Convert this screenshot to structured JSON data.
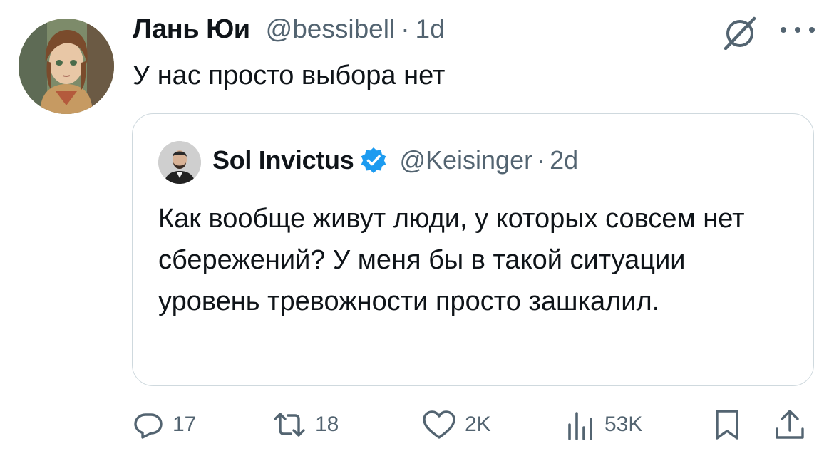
{
  "tweet": {
    "display_name": "Лань Юи",
    "handle": "@bessibell",
    "separator": "·",
    "time": "1d",
    "text": "У нас просто выбора нет"
  },
  "quote": {
    "display_name": "Sol Invictus",
    "handle": "@Keisinger",
    "separator": "·",
    "time": "2d",
    "text": "Как вообще живут люди, у которых совсем нет сбережений? У меня бы в такой ситуации уровень тревожности просто зашкалил."
  },
  "actions": {
    "replies": "17",
    "reposts": "18",
    "likes": "2K",
    "views": "53K"
  },
  "icons": [
    "grok-icon",
    "more-icon",
    "verified-badge-icon",
    "reply-icon",
    "repost-icon",
    "like-icon",
    "views-icon",
    "bookmark-icon",
    "share-icon"
  ],
  "colors": {
    "text": "#0f1419",
    "secondary": "#536471",
    "border": "#cfd9de",
    "verified": "#1d9bf0"
  }
}
